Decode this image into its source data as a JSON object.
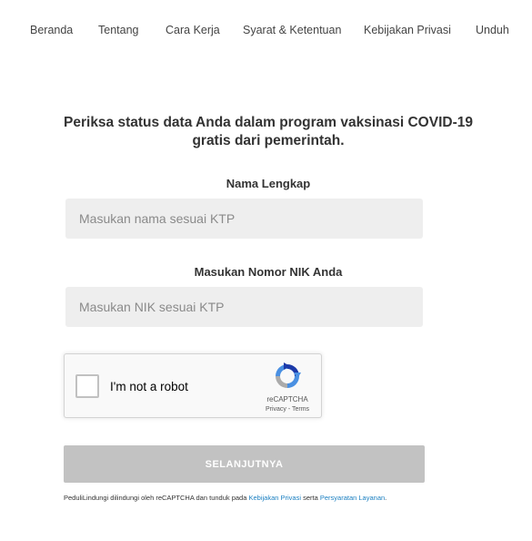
{
  "nav": {
    "items": [
      "Beranda",
      "Tentang",
      "Cara Kerja",
      "Syarat & Ketentuan",
      "Kebijakan Privasi",
      "Unduh"
    ]
  },
  "heading": "Periksa status data Anda dalam program vaksinasi COVID-19 gratis dari pemerintah.",
  "form": {
    "name": {
      "label": "Nama Lengkap",
      "placeholder": "Masukan nama sesuai KTP",
      "value": ""
    },
    "nik": {
      "label": "Masukan Nomor NIK Anda",
      "placeholder": "Masukan NIK sesuai KTP",
      "value": ""
    }
  },
  "captcha": {
    "label": "I'm not a robot",
    "brand": "reCAPTCHA",
    "privacy": "Privacy",
    "separator": " - ",
    "terms": "Terms",
    "checked": false,
    "icon": "recaptcha-logo-icon"
  },
  "submit": {
    "label": "SELANJUTNYA"
  },
  "notice": {
    "prefix": "PeduliLindungi dilindungi oleh reCAPTCHA dan tunduk pada ",
    "privacy_link": "Kebijakan Privasi",
    "middle": " serta ",
    "terms_link": "Persyaratan Layanan",
    "suffix": "."
  },
  "colors": {
    "button_disabled": "#c2c2c2",
    "input_bg": "#eeeeee",
    "link": "#1a7fc1"
  }
}
